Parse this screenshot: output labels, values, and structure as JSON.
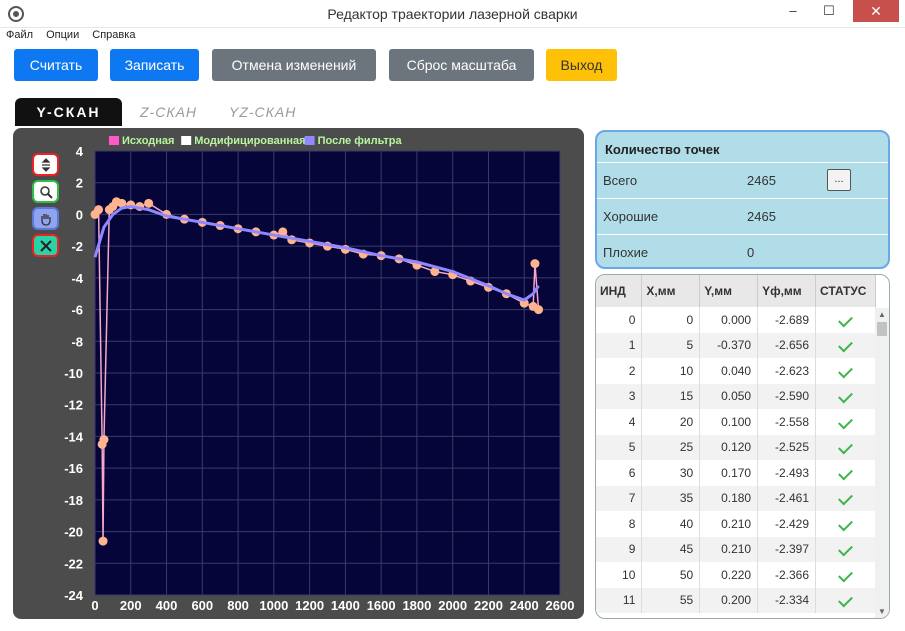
{
  "window": {
    "title": "Редактор траектории лазерной сварки",
    "minimize": "–",
    "maximize": "☐",
    "close": "✕"
  },
  "menu": [
    "Файл",
    "Опции",
    "Справка"
  ],
  "toolbar": {
    "read": "Считать",
    "write": "Записать",
    "undo": "Отмена изменений",
    "reset_zoom": "Сброс масштаба",
    "exit": "Выход"
  },
  "tabs": [
    "Y-СКАН",
    "Z-СКАН",
    "YZ-СКАН"
  ],
  "chart_tools": [
    "vertical-fit-icon",
    "zoom-icon",
    "pan-hand-icon",
    "cross-select-icon"
  ],
  "chart_data": {
    "type": "line",
    "legend": [
      "Исходная",
      "Модифицированная",
      "После фильтра"
    ],
    "legend_colors": [
      "#ff59c7",
      "#ffffff",
      "#8f88ff"
    ],
    "xlim": [
      0,
      2600
    ],
    "ylim": [
      -24,
      4
    ],
    "x_ticks": [
      0,
      200,
      400,
      600,
      800,
      1000,
      1200,
      1400,
      1600,
      1800,
      2000,
      2200,
      2400,
      2600
    ],
    "y_ticks": [
      4,
      2,
      0,
      -2,
      -4,
      -6,
      -8,
      -10,
      -12,
      -14,
      -16,
      -18,
      -20,
      -22,
      -24
    ],
    "grid": true,
    "series": [
      {
        "name": "Исходная",
        "x": [
          0,
          20,
          40,
          45,
          50,
          80,
          100,
          120,
          150,
          200,
          250,
          300,
          400,
          500,
          600,
          700,
          800,
          900,
          1000,
          1050,
          1100,
          1200,
          1300,
          1400,
          1500,
          1600,
          1700,
          1800,
          1900,
          2000,
          2100,
          2200,
          2300,
          2400,
          2450,
          2460,
          2480
        ],
        "y": [
          0.0,
          0.3,
          -14.5,
          -20.6,
          -14.2,
          0.3,
          0.5,
          0.8,
          0.7,
          0.6,
          0.5,
          0.7,
          0.0,
          -0.3,
          -0.5,
          -0.7,
          -0.9,
          -1.1,
          -1.3,
          -1.1,
          -1.6,
          -1.8,
          -2.0,
          -2.2,
          -2.5,
          -2.6,
          -2.8,
          -3.2,
          -3.6,
          -3.8,
          -4.2,
          -4.6,
          -5.0,
          -5.6,
          -5.8,
          -3.1,
          -6.0
        ]
      },
      {
        "name": "После фильтра",
        "x": [
          0,
          50,
          100,
          150,
          200,
          300,
          400,
          600,
          800,
          1000,
          1200,
          1400,
          1600,
          1800,
          2000,
          2200,
          2300,
          2400,
          2450,
          2480
        ],
        "y": [
          -2.7,
          -0.8,
          0.0,
          0.4,
          0.5,
          0.3,
          -0.1,
          -0.5,
          -0.9,
          -1.3,
          -1.7,
          -2.1,
          -2.6,
          -3.0,
          -3.6,
          -4.5,
          -5.0,
          -5.4,
          -5.0,
          -4.5
        ]
      }
    ]
  },
  "points_info": {
    "header": "Количество точек",
    "rows": [
      {
        "label": "Всего",
        "value": "2465"
      },
      {
        "label": "Хорошие",
        "value": "2465"
      },
      {
        "label": "Плохие",
        "value": "0"
      }
    ],
    "more_button": "..."
  },
  "table": {
    "columns": [
      "ИНД",
      "X,мм",
      "Y,мм",
      "Yф,мм",
      "СТАТУС"
    ],
    "rows": [
      [
        "0",
        "0",
        "0.000",
        "-2.689"
      ],
      [
        "1",
        "5",
        "-0.370",
        "-2.656"
      ],
      [
        "2",
        "10",
        "0.040",
        "-2.623"
      ],
      [
        "3",
        "15",
        "0.050",
        "-2.590"
      ],
      [
        "4",
        "20",
        "0.100",
        "-2.558"
      ],
      [
        "5",
        "25",
        "0.120",
        "-2.525"
      ],
      [
        "6",
        "30",
        "0.170",
        "-2.493"
      ],
      [
        "7",
        "35",
        "0.180",
        "-2.461"
      ],
      [
        "8",
        "40",
        "0.210",
        "-2.429"
      ],
      [
        "9",
        "45",
        "0.210",
        "-2.397"
      ],
      [
        "10",
        "50",
        "0.220",
        "-2.366"
      ],
      [
        "11",
        "55",
        "0.200",
        "-2.334"
      ]
    ],
    "status_icon": "check-icon"
  }
}
